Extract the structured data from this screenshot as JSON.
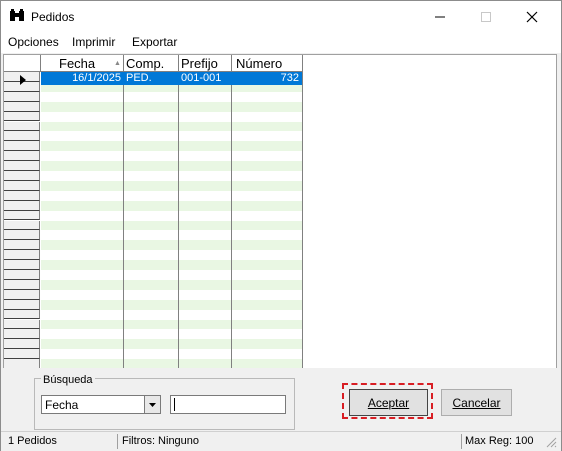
{
  "window": {
    "title": "Pedidos"
  },
  "menu": {
    "items": [
      "Opciones",
      "Imprimir",
      "Exportar"
    ]
  },
  "grid": {
    "columns": [
      "Fecha",
      "Comp.",
      "Prefijo",
      "Número"
    ],
    "rows": [
      {
        "fecha": "16/1/2025",
        "comp": "PED.",
        "prefijo": "001-001",
        "numero": "732"
      }
    ]
  },
  "search": {
    "group_label": "Búsqueda",
    "field_select_value": "Fecha",
    "input_value": ""
  },
  "buttons": {
    "accept": "Aceptar",
    "cancel": "Cancelar"
  },
  "status": {
    "count": "1 Pedidos",
    "filters": "Filtros: Ninguno",
    "max_reg": "Max Reg: 100"
  },
  "colors": {
    "selection": "#0078d7",
    "row_alt": "#e9f7e3",
    "highlight_outline": "#d81e24"
  }
}
